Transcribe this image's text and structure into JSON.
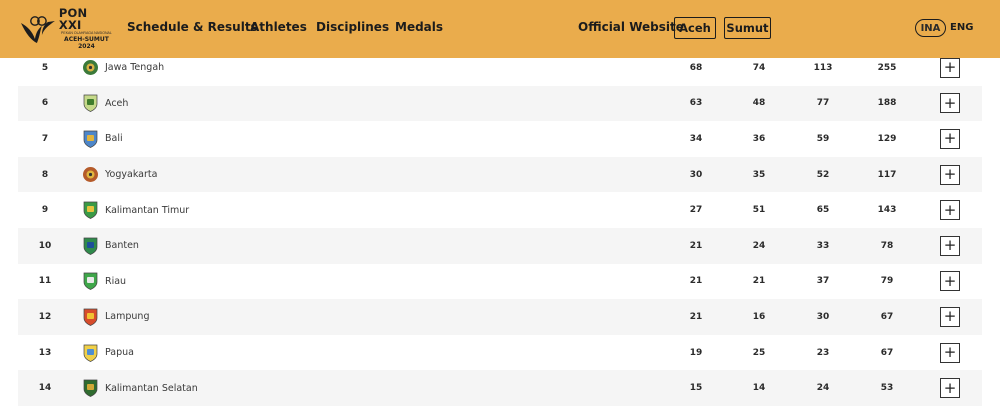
{
  "header": {
    "logo": {
      "title": "PON XXI",
      "subtitle": "PEKAN OLAHRAGA NASIONAL",
      "line1": "ACEH-SUMUT",
      "line2": "2024"
    },
    "nav": [
      {
        "label": "Schedule & Results"
      },
      {
        "label": "Athletes"
      },
      {
        "label": "Disciplines"
      },
      {
        "label": "Medals"
      }
    ],
    "official_label": "Official Website",
    "sites": [
      {
        "label": "Aceh"
      },
      {
        "label": "Sumut"
      }
    ],
    "lang_active": "INA",
    "lang_other": "ENG"
  },
  "colors": {
    "header_bg": "#eaac4c",
    "row_shade": "#f5f5f5"
  },
  "rows": [
    {
      "rank": "5",
      "province": "Jawa Tengah",
      "gold": "68",
      "silver": "74",
      "bronze": "113",
      "total": "255",
      "crest": "central-java-crest-icon",
      "expand": "+"
    },
    {
      "rank": "6",
      "province": "Aceh",
      "gold": "63",
      "silver": "48",
      "bronze": "77",
      "total": "188",
      "crest": "aceh-crest-icon",
      "expand": "+"
    },
    {
      "rank": "7",
      "province": "Bali",
      "gold": "34",
      "silver": "36",
      "bronze": "59",
      "total": "129",
      "crest": "bali-crest-icon",
      "expand": "+"
    },
    {
      "rank": "8",
      "province": "Yogyakarta",
      "gold": "30",
      "silver": "35",
      "bronze": "52",
      "total": "117",
      "crest": "yogyakarta-crest-icon",
      "expand": "+"
    },
    {
      "rank": "9",
      "province": "Kalimantan Timur",
      "gold": "27",
      "silver": "51",
      "bronze": "65",
      "total": "143",
      "crest": "east-kalimantan-crest-icon",
      "expand": "+"
    },
    {
      "rank": "10",
      "province": "Banten",
      "gold": "21",
      "silver": "24",
      "bronze": "33",
      "total": "78",
      "crest": "banten-crest-icon",
      "expand": "+"
    },
    {
      "rank": "11",
      "province": "Riau",
      "gold": "21",
      "silver": "21",
      "bronze": "37",
      "total": "79",
      "crest": "riau-crest-icon",
      "expand": "+"
    },
    {
      "rank": "12",
      "province": "Lampung",
      "gold": "21",
      "silver": "16",
      "bronze": "30",
      "total": "67",
      "crest": "lampung-crest-icon",
      "expand": "+"
    },
    {
      "rank": "13",
      "province": "Papua",
      "gold": "19",
      "silver": "25",
      "bronze": "23",
      "total": "67",
      "crest": "papua-crest-icon",
      "expand": "+"
    },
    {
      "rank": "14",
      "province": "Kalimantan Selatan",
      "gold": "15",
      "silver": "14",
      "bronze": "24",
      "total": "53",
      "crest": "south-kalimantan-crest-icon",
      "expand": "+"
    }
  ]
}
